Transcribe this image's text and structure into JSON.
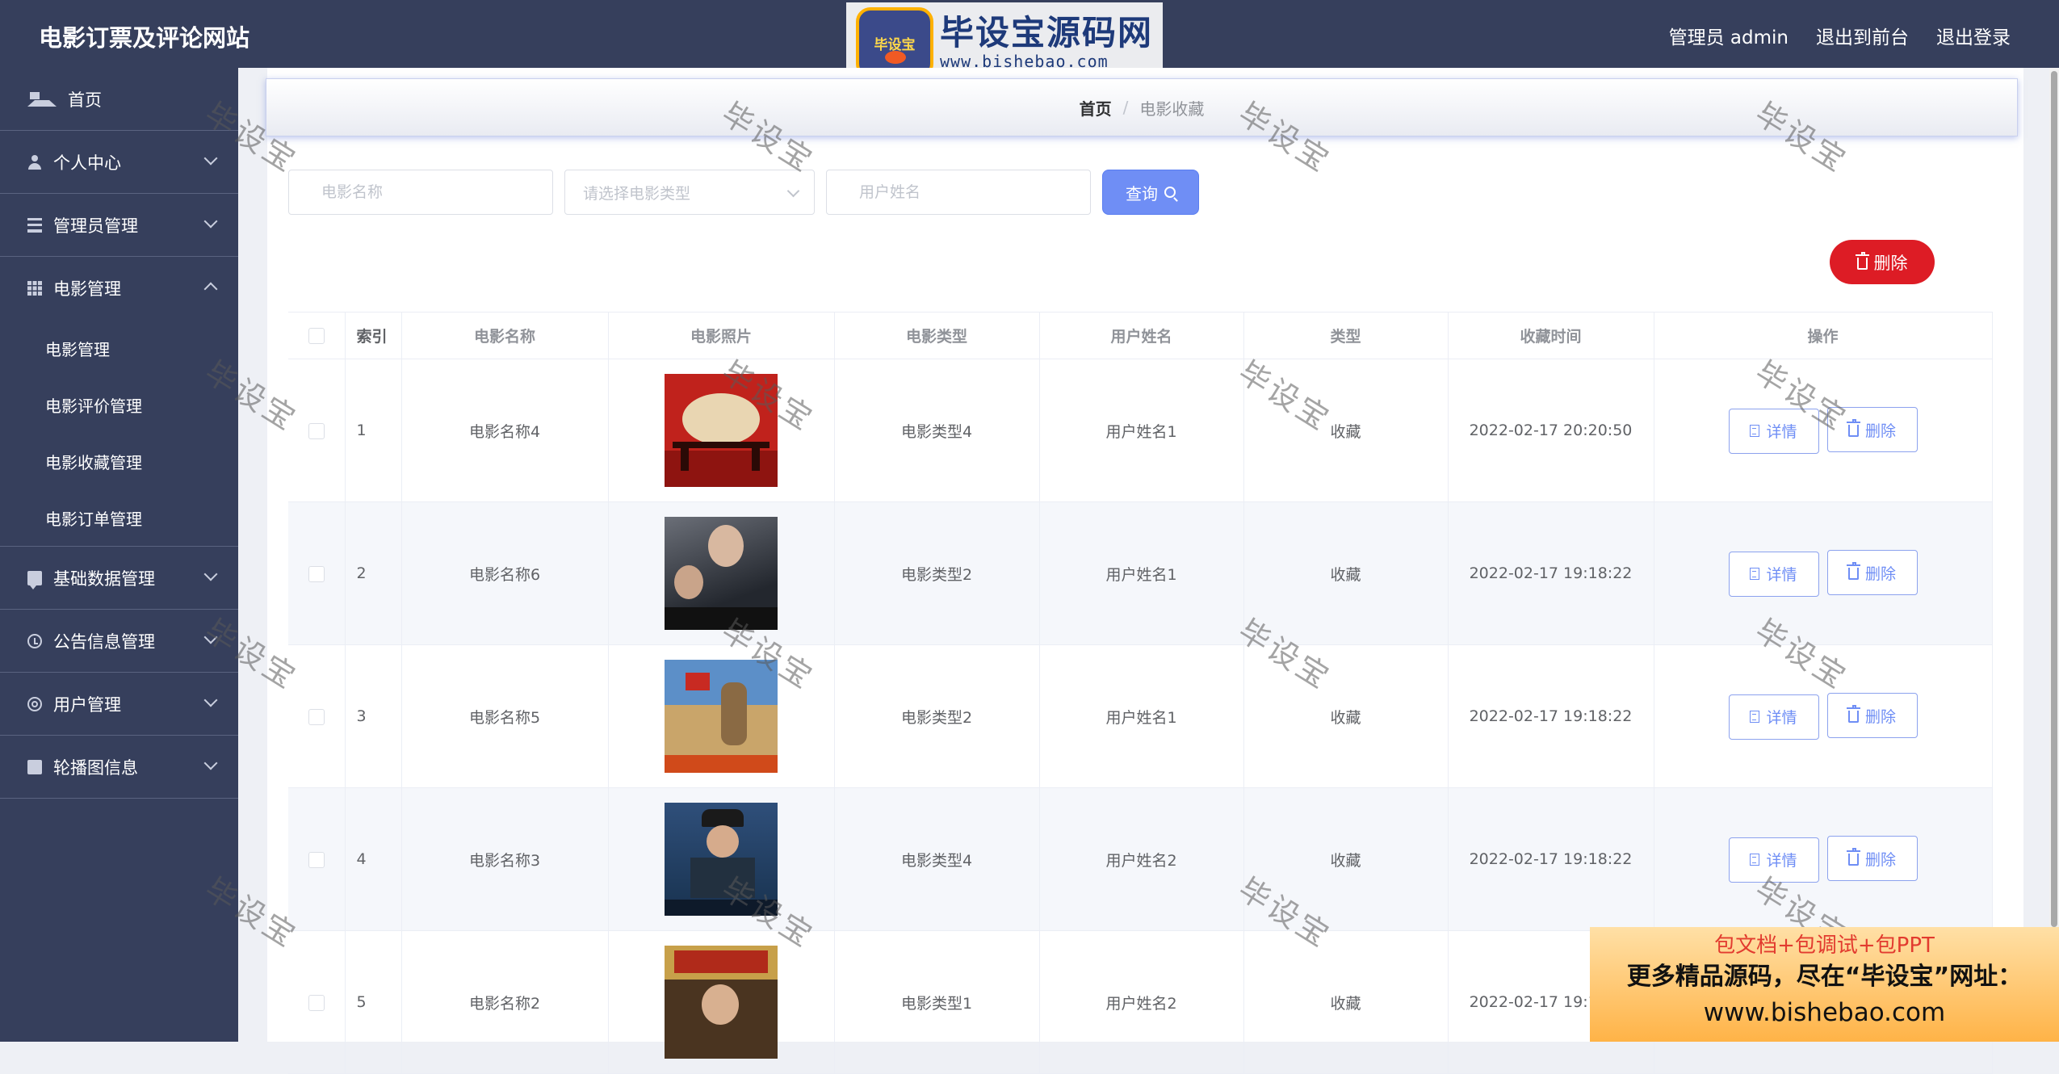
{
  "header": {
    "title": "电影订票及评论网站",
    "admin_label": "管理员 admin",
    "to_front": "退出到前台",
    "logout": "退出登录"
  },
  "logo": {
    "badge": "毕设宝",
    "main": "毕设宝源码网",
    "sub": "www.bishebao.com"
  },
  "sidebar": {
    "home": "首页",
    "personal": "个人中心",
    "admin_mgmt": "管理员管理",
    "movie_mgmt": "电影管理",
    "sub": [
      "电影管理",
      "电影评价管理",
      "电影收藏管理",
      "电影订单管理"
    ],
    "basic_data": "基础数据管理",
    "notice": "公告信息管理",
    "user_mgmt": "用户管理",
    "carousel": "轮播图信息"
  },
  "breadcrumb": {
    "home": "首页",
    "sep": "/",
    "current": "电影收藏"
  },
  "search": {
    "movie_name_placeholder": "电影名称",
    "movie_type_placeholder": "请选择电影类型",
    "user_name_placeholder": "用户姓名",
    "query_label": "查询"
  },
  "delete_label": "删除",
  "table": {
    "headers": [
      "索引",
      "电影名称",
      "电影照片",
      "电影类型",
      "用户姓名",
      "类型",
      "收藏时间",
      "操作"
    ],
    "rows": [
      {
        "index": "1",
        "name": "电影名称4",
        "type": "电影类型4",
        "user": "用户姓名1",
        "kind": "收藏",
        "time": "2022-02-17 20:20:50"
      },
      {
        "index": "2",
        "name": "电影名称6",
        "type": "电影类型2",
        "user": "用户姓名1",
        "kind": "收藏",
        "time": "2022-02-17 19:18:22"
      },
      {
        "index": "3",
        "name": "电影名称5",
        "type": "电影类型2",
        "user": "用户姓名1",
        "kind": "收藏",
        "time": "2022-02-17 19:18:22"
      },
      {
        "index": "4",
        "name": "电影名称3",
        "type": "电影类型4",
        "user": "用户姓名2",
        "kind": "收藏",
        "time": "2022-02-17 19:18:22"
      },
      {
        "index": "5",
        "name": "电影名称2",
        "type": "电影类型1",
        "user": "用户姓名2",
        "kind": "收藏",
        "time": "2022-02-17 19:18:22"
      }
    ],
    "detail_label": "详情",
    "delete_label": "删除"
  },
  "watermark": "毕设宝",
  "ad": {
    "line1": "包文档+包调试+包PPT",
    "line2": "更多精品源码，尽在“毕设宝”网址：",
    "line3": "www.bishebao.com"
  },
  "colors": {
    "sidebar": "#363f5c",
    "primary": "#6f8ef5",
    "danger": "#dd1c25"
  }
}
